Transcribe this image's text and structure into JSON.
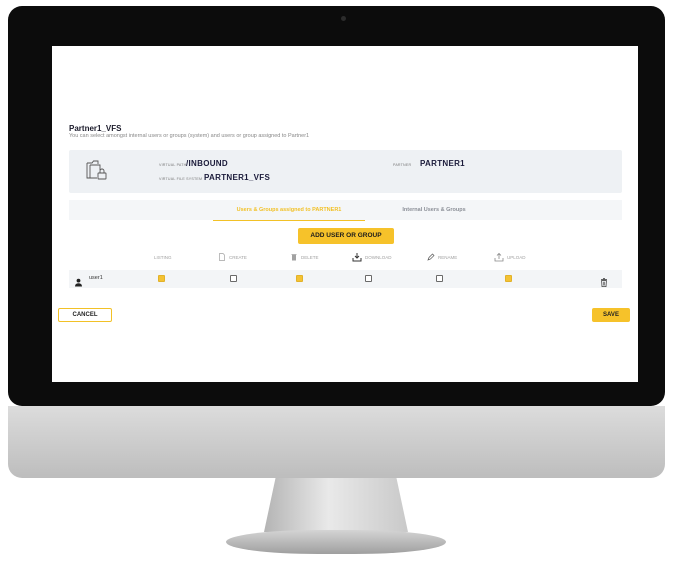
{
  "vfs": {
    "title": "Partner1_VFS",
    "subtitle": "You can select amongst internal users or groups (system) and users or group assigned to Partner1"
  },
  "info": {
    "virtual_path_label": "Virtual Path",
    "virtual_path_value": "/INBOUND",
    "virtual_fs_label": "Virtual File System",
    "virtual_fs_value": "PARTNER1_VFS",
    "partner_label": "Partner",
    "partner_value": "PARTNER1"
  },
  "tabs": [
    {
      "label": "Users & Groups assigned to PARTNER1",
      "active": true
    },
    {
      "label": "Internal Users & Groups",
      "active": false
    }
  ],
  "add_button": "ADD USER OR GROUP",
  "columns": [
    {
      "label": "LISTING",
      "icon": ""
    },
    {
      "label": "CREATE",
      "icon": "file-icon"
    },
    {
      "label": "DELETE",
      "icon": "trash-icon"
    },
    {
      "label": "DOWNLOAD",
      "icon": "download-icon"
    },
    {
      "label": "RENAME",
      "icon": "pencil-icon"
    },
    {
      "label": "UPLOAD",
      "icon": "upload-icon"
    }
  ],
  "row": {
    "user": "user1",
    "user_icon": "person-icon",
    "permissions": [
      true,
      false,
      true,
      false,
      false,
      true
    ],
    "delete_icon": "trash-icon"
  },
  "footer": {
    "cancel": "CANCEL",
    "save": "SAVE"
  },
  "colors": {
    "accent": "#f6c22a",
    "bezel": "#0c0c0c",
    "card": "#eef1f4",
    "active_tab": "#f2c127",
    "inactive_tab": "#8b8f97"
  }
}
